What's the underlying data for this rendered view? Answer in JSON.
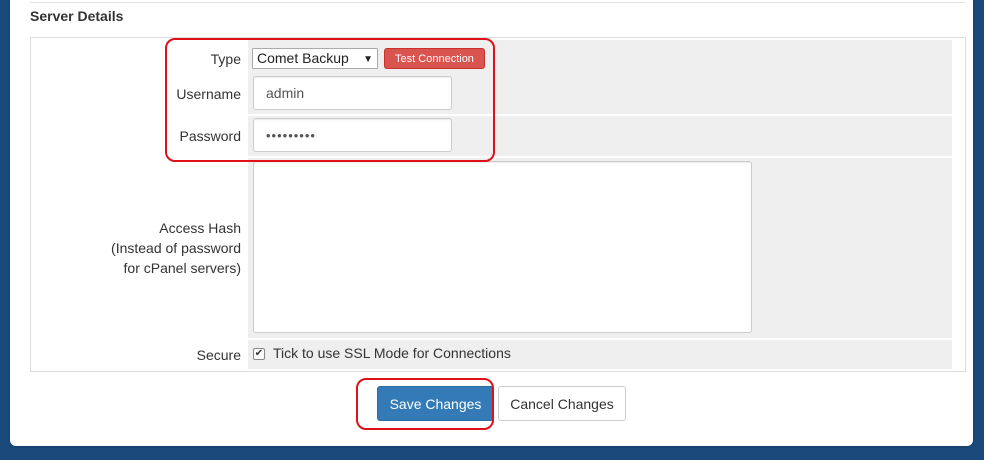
{
  "section": {
    "title": "Server Details"
  },
  "form": {
    "type": {
      "label": "Type",
      "selected": "Comet Backup",
      "test_button": "Test Connection"
    },
    "username": {
      "label": "Username",
      "value": "admin"
    },
    "password": {
      "label": "Password",
      "value": "•••••••••"
    },
    "access_hash": {
      "label_line1": "Access Hash",
      "label_line2": "(Instead of password",
      "label_line3": "for cPanel servers)",
      "value": ""
    },
    "secure": {
      "label": "Secure",
      "checked": true,
      "check_text": "Tick to use SSL Mode for Connections"
    }
  },
  "actions": {
    "save_label": "Save Changes",
    "cancel_label": "Cancel Changes"
  },
  "colors": {
    "highlight": "#e0101a",
    "primary": "#337ab7",
    "danger": "#d9534f",
    "page_bg": "#1a4a7c"
  }
}
